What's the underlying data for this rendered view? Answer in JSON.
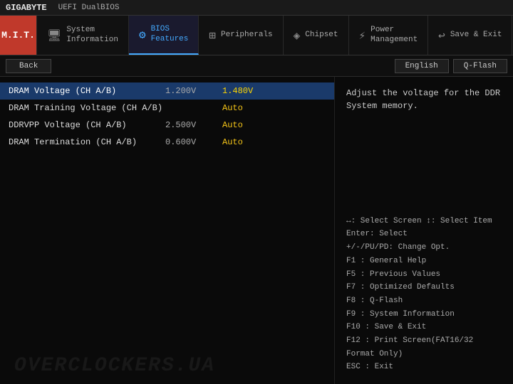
{
  "titlebar": {
    "logo": "GIGABYTE",
    "app": "UEFI DualBIOS"
  },
  "navbar": {
    "mit_label": "M.I.T.",
    "items": [
      {
        "id": "system-information",
        "icon": "🖥",
        "label": "System\nInformation",
        "active": false
      },
      {
        "id": "bios-features",
        "icon": "⚙",
        "label": "BIOS\nFeatures",
        "active": true
      },
      {
        "id": "peripherals",
        "icon": "⊞",
        "label": "Peripherals",
        "active": false
      },
      {
        "id": "chipset",
        "icon": "◈",
        "label": "Chipset",
        "active": false
      },
      {
        "id": "power-management",
        "icon": "⚡",
        "label": "Power\nManagement",
        "active": false
      },
      {
        "id": "save-exit",
        "icon": "↩",
        "label": "Save & Exit",
        "active": false
      }
    ]
  },
  "toolbar": {
    "back_label": "Back",
    "lang_label": "English",
    "qflash_label": "Q-Flash"
  },
  "settings": [
    {
      "name": "DRAM Voltage    (CH A/B)",
      "value1": "1.200V",
      "value2": "1.480V",
      "highlighted": true
    },
    {
      "name": "DRAM Training Voltage  (CH A/B)",
      "value1": "",
      "value2": "Auto",
      "highlighted": false
    },
    {
      "name": "DDRVPP Voltage  (CH A/B)",
      "value1": "2.500V",
      "value2": "Auto",
      "highlighted": false
    },
    {
      "name": "DRAM Termination  (CH A/B)",
      "value1": "0.600V",
      "value2": "Auto",
      "highlighted": false
    }
  ],
  "description": "Adjust the voltage for the DDR System memory.",
  "help": {
    "lines": [
      "↔: Select Screen  ↕: Select Item",
      "Enter: Select",
      "+/-/PU/PD: Change Opt.",
      "F1  : General Help",
      "F5  : Previous Values",
      "F7  : Optimized Defaults",
      "F8  : Q-Flash",
      "F9  : System Information",
      "F10 : Save & Exit",
      "F12 : Print Screen(FAT16/32 Format Only)",
      "ESC : Exit"
    ]
  },
  "watermark": "OVERCLOCKERS.UA"
}
